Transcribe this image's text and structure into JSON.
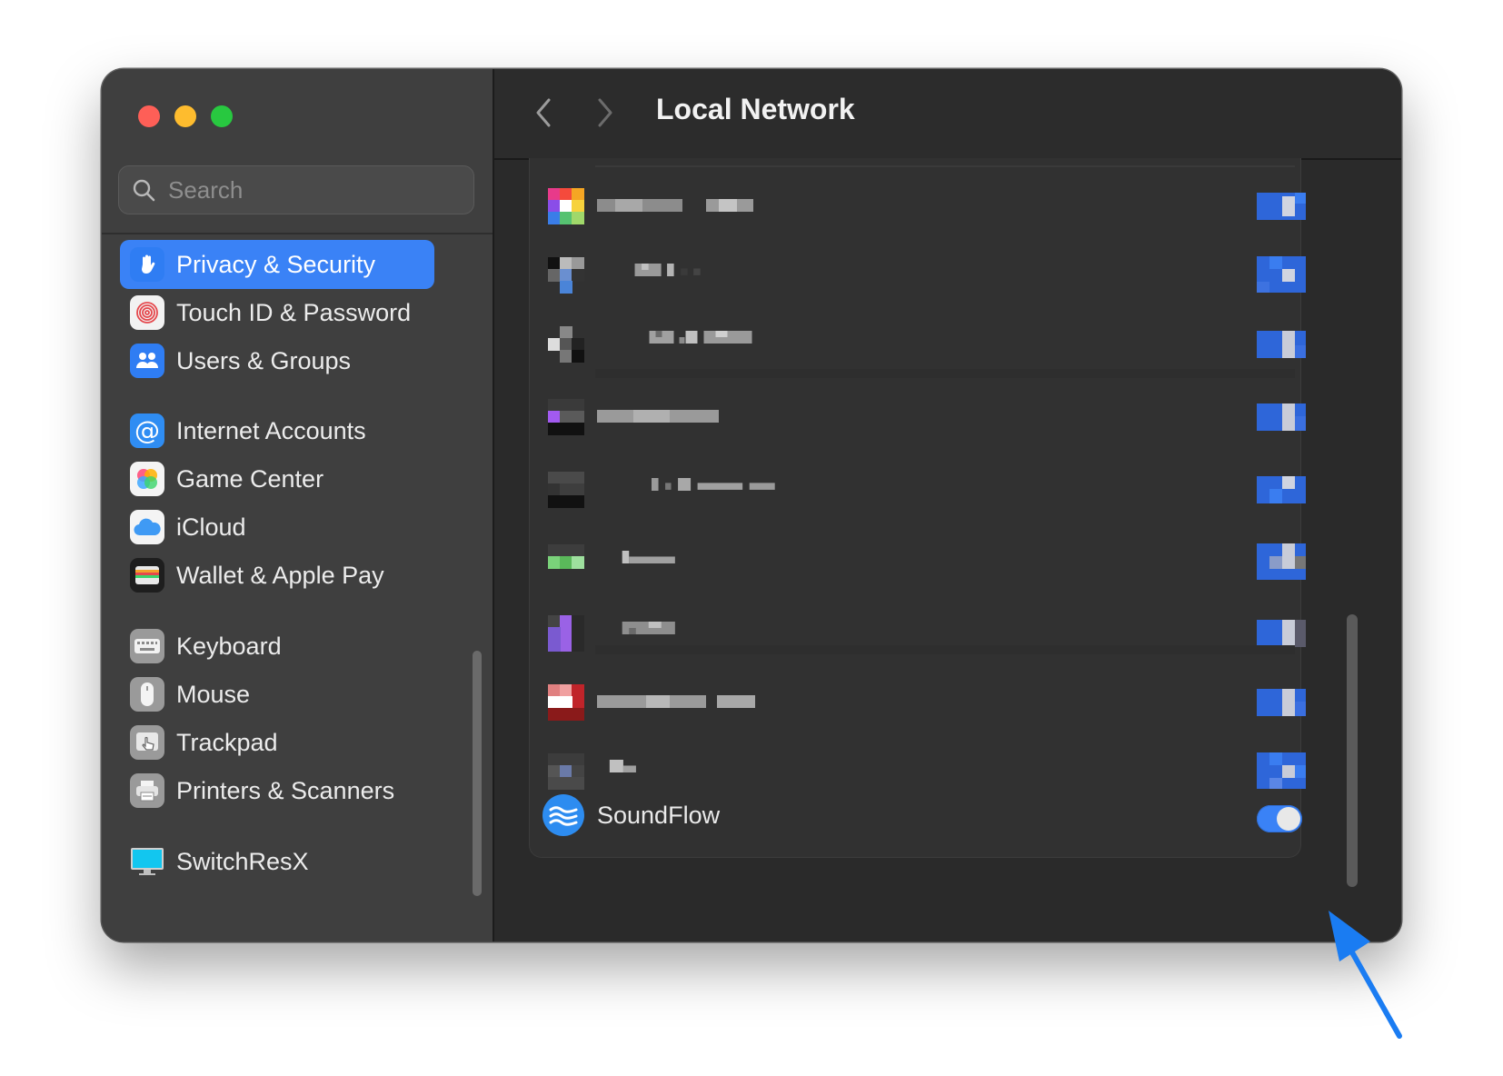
{
  "window": {
    "title": "Local Network"
  },
  "sidebar": {
    "search_placeholder": "Search",
    "items": [
      {
        "label": "Privacy & Security",
        "icon": "hand-raised-icon",
        "selected": true
      },
      {
        "label": "Touch ID & Password",
        "icon": "fingerprint-icon"
      },
      {
        "label": "Users & Groups",
        "icon": "users-icon"
      },
      {
        "label": "Internet Accounts",
        "icon": "at-sign-icon"
      },
      {
        "label": "Game Center",
        "icon": "game-center-icon"
      },
      {
        "label": "iCloud",
        "icon": "cloud-icon"
      },
      {
        "label": "Wallet & Apple Pay",
        "icon": "wallet-icon"
      },
      {
        "label": "Keyboard",
        "icon": "keyboard-icon"
      },
      {
        "label": "Mouse",
        "icon": "mouse-icon"
      },
      {
        "label": "Trackpad",
        "icon": "trackpad-icon"
      },
      {
        "label": "Printers & Scanners",
        "icon": "printer-icon"
      },
      {
        "label": "SwitchResX",
        "icon": "monitor-icon"
      }
    ]
  },
  "main": {
    "apps": [
      {
        "label": "SoundFlow",
        "icon": "soundflow-icon",
        "enabled": true
      }
    ]
  },
  "colors": {
    "accent": "#3a82f6",
    "arrow": "#1a7cf2",
    "window_bg": "#2a2a2a",
    "sidebar_bg": "#3f3f3f"
  }
}
